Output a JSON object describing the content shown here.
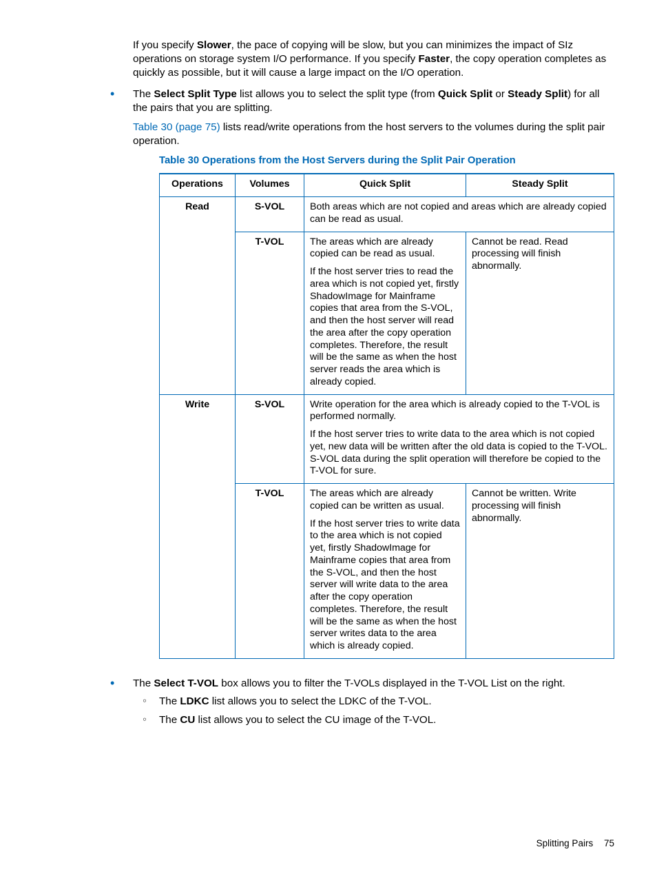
{
  "intro": {
    "p1_a": "If you specify ",
    "p1_b": "Slower",
    "p1_c": ", the pace of copying will be slow, but you can minimizes the impact of SIz operations on storage system I/O performance. If you specify ",
    "p1_d": "Faster",
    "p1_e": ", the copy operation completes as quickly as possible, but it will cause a large impact on the I/O operation."
  },
  "bullet1": {
    "a": "The ",
    "b": "Select Split Type",
    "c": " list allows you to select the split type (from ",
    "d": "Quick Split",
    "e": " or ",
    "f": "Steady Split",
    "g": ") for all the pairs that you are splitting.",
    "ref_link": "Table 30 (page 75)",
    "ref_rest": " lists read/write operations from the host servers to the volumes during the split pair operation."
  },
  "table_caption": "Table 30 Operations from the Host Servers during the Split Pair Operation",
  "table": {
    "headers": {
      "ops": "Operations",
      "vols": "Volumes",
      "qs": "Quick Split",
      "ss": "Steady Split"
    },
    "read_label": "Read",
    "write_label": "Write",
    "svol_label": "S-VOL",
    "tvol_label": "T-VOL",
    "read_svol_merged": "Both areas which are not copied and areas which are already copied can be read as usual.",
    "read_tvol_qs_p1": "The areas which are already copied can be read as usual.",
    "read_tvol_qs_p2": "If the host server tries to read the area which is not copied yet, firstly ShadowImage for Mainframe copies that area from the S-VOL, and then the host server will read the area after the copy operation completes. Therefore, the result will be the same as when the host server reads the area which is already copied.",
    "read_tvol_ss": "Cannot be read. Read processing will finish abnormally.",
    "write_svol_p1": "Write operation for the area which is already copied to the T-VOL is performed normally.",
    "write_svol_p2": "If the host server tries to write data to the area which is not copied yet, new data will be written after the old data is copied to the T-VOL. S-VOL data during the split operation will therefore be copied to the T-VOL for sure.",
    "write_tvol_qs_p1": "The areas which are already copied can be written as usual.",
    "write_tvol_qs_p2": "If the host server tries to write data to the area which is not copied yet, firstly ShadowImage for Mainframe copies that area from the S-VOL, and then the host server will write data to the area after the copy operation completes. Therefore, the result will be the same as when the host server writes data to the area which is already copied.",
    "write_tvol_ss": "Cannot be written. Write processing will finish abnormally."
  },
  "bullet2": {
    "a": "The ",
    "b": "Select T-VOL",
    "c": " box allows you to filter the T-VOLs displayed in the T-VOL List on the right.",
    "sub1_a": "The ",
    "sub1_b": "LDKC",
    "sub1_c": " list allows you to select the LDKC of the T-VOL.",
    "sub2_a": "The ",
    "sub2_b": "CU",
    "sub2_c": " list allows you to select the CU image of the T-VOL."
  },
  "footer": {
    "section": "Splitting Pairs",
    "page": "75"
  }
}
